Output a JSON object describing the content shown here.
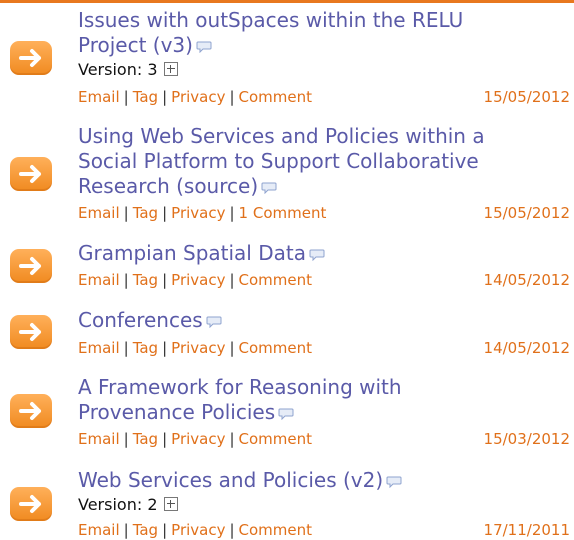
{
  "items": [
    {
      "title_lines": [
        "Issues with outSpaces within the RELU",
        "Project (v3)"
      ],
      "version_label": "Version:",
      "version": "3",
      "links": {
        "email": "Email",
        "tag": "Tag",
        "privacy": "Privacy",
        "comment": "Comment"
      },
      "date": "15/05/2012"
    },
    {
      "title_lines": [
        "Using Web Services and Policies within a",
        "Social Platform to Support Collaborative",
        "Research (source)"
      ],
      "links": {
        "email": "Email",
        "tag": "Tag",
        "privacy": "Privacy",
        "comment": "1 Comment"
      },
      "date": "15/05/2012"
    },
    {
      "title_lines": [
        "Grampian Spatial Data"
      ],
      "links": {
        "email": "Email",
        "tag": "Tag",
        "privacy": "Privacy",
        "comment": "Comment"
      },
      "date": "14/05/2012"
    },
    {
      "title_lines": [
        "Conferences"
      ],
      "links": {
        "email": "Email",
        "tag": "Tag",
        "privacy": "Privacy",
        "comment": "Comment"
      },
      "date": "14/05/2012"
    },
    {
      "title_lines": [
        "A Framework for Reasoning with",
        "Provenance Policies"
      ],
      "links": {
        "email": "Email",
        "tag": "Tag",
        "privacy": "Privacy",
        "comment": "Comment"
      },
      "date": "15/03/2012"
    },
    {
      "title_lines": [
        "Web Services and Policies (v2)"
      ],
      "version_label": "Version:",
      "version": "2",
      "links": {
        "email": "Email",
        "tag": "Tag",
        "privacy": "Privacy",
        "comment": "Comment"
      },
      "date": "17/11/2011"
    }
  ],
  "icons": {
    "item": "arrow-right-icon",
    "comment": "speech-bubble-icon",
    "expand": "plus-box-icon"
  },
  "colors": {
    "accent": "#e0701a",
    "title": "#5a5aa8",
    "arrow": "#f08a20"
  }
}
